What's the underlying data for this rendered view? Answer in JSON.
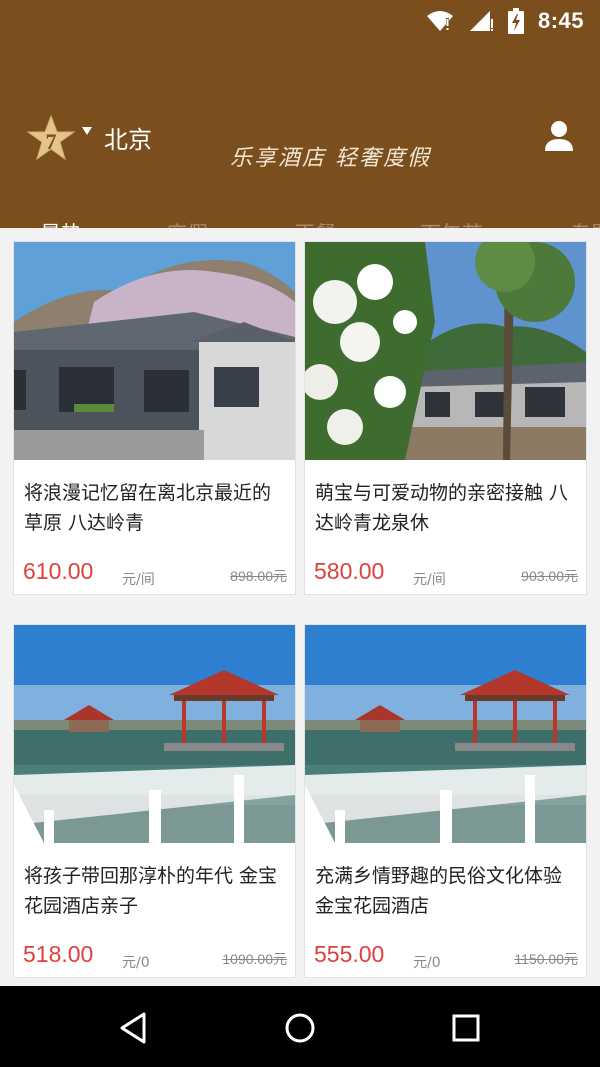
{
  "status_bar": {
    "time": "8:45"
  },
  "header": {
    "logo_number": "7",
    "city": "北京",
    "slogan": "乐享酒店 轻奢度假"
  },
  "tabs": [
    {
      "label": "最热",
      "active": true
    },
    {
      "label": "度假",
      "active": false
    },
    {
      "label": "正餐",
      "active": false
    },
    {
      "label": "下午茶",
      "active": false
    },
    {
      "label": "专题",
      "active": false
    }
  ],
  "products": [
    {
      "title": "将浪漫记忆留在离北京最近的草原 八达岭青",
      "price": "610.00",
      "unit": "元/间",
      "original_price": "898.00元"
    },
    {
      "title": "萌宝与可爱动物的亲密接触 八达岭青龙泉休",
      "price": "580.00",
      "unit": "元/间",
      "original_price": "903.00元"
    },
    {
      "title": "将孩子带回那淳朴的年代 金宝花园酒店亲子",
      "price": "518.00",
      "unit": "元/0",
      "original_price": "1090.00元"
    },
    {
      "title": "充满乡情野趣的民俗文化体验 金宝花园酒店",
      "price": "555.00",
      "unit": "元/0",
      "original_price": "1150.00元"
    }
  ],
  "colors": {
    "brand_brown": "#7a4f1d",
    "price_red": "#e0403d"
  }
}
